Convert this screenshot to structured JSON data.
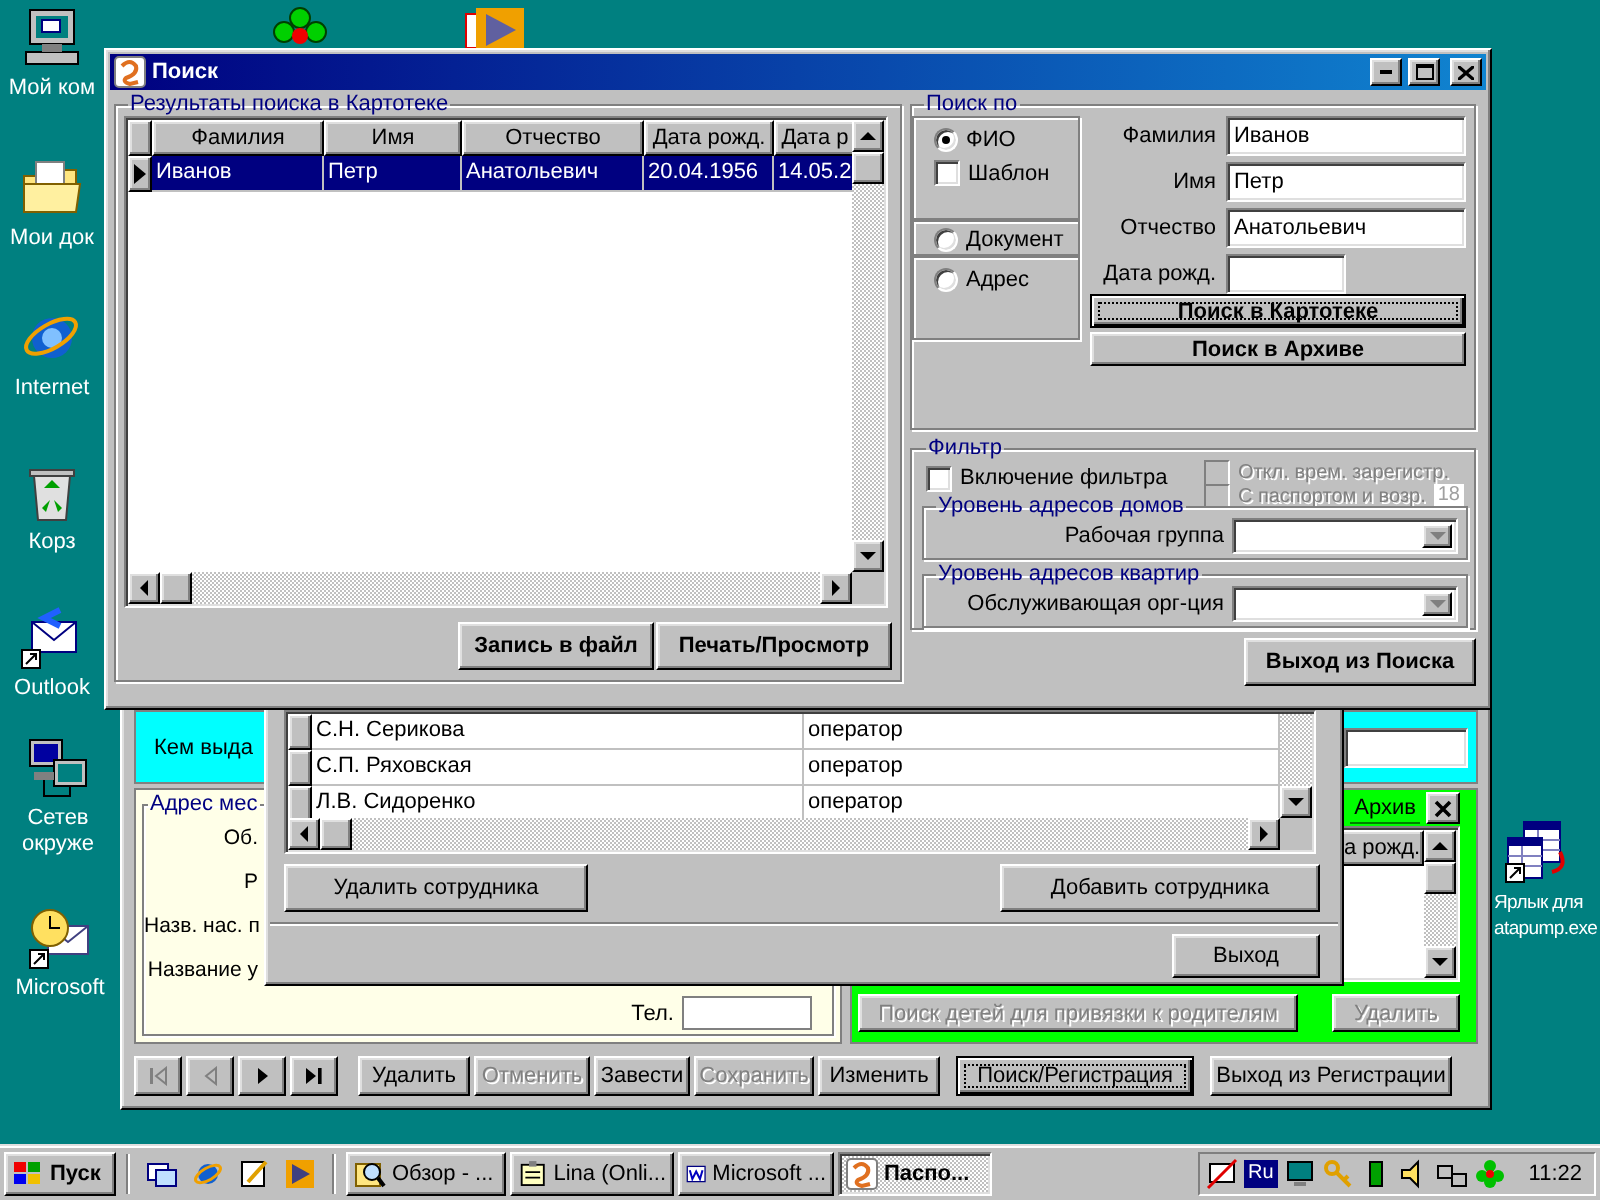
{
  "desktop_icons": [
    {
      "kind": "computer",
      "lines": [
        "Мой ком"
      ]
    },
    {
      "kind": "folder",
      "lines": [
        "Мои док"
      ]
    },
    {
      "kind": "browser",
      "lines": [
        "Internet"
      ]
    },
    {
      "kind": "recycle",
      "lines": [
        "Корз"
      ]
    },
    {
      "kind": "mail",
      "lines": [
        "Outlook"
      ]
    },
    {
      "kind": "network",
      "lines": [
        "Сетев",
        "окруже"
      ]
    },
    {
      "kind": "scheduler",
      "lines": [
        "Microsoft"
      ]
    },
    {
      "kind": "table",
      "lines": [
        "Ярлык для",
        "atapump.exe"
      ]
    }
  ],
  "registration_window": {
    "issued_by_label": "Кем выда",
    "address": {
      "title": "Адрес мес",
      "labels": [
        "Об.",
        "Р",
        "Назв. нас. п",
        "Название у"
      ],
      "phone_label": "Тел."
    },
    "archive": {
      "tab": "Архив",
      "column": "а рожд.",
      "buttons": [
        {
          "label": "Поиск детей для привязки к родителям",
          "disabled": true
        },
        {
          "label": "Удалить",
          "disabled": true
        }
      ]
    },
    "navigator": [
      {
        "kind": "first",
        "disabled": true
      },
      {
        "kind": "prev",
        "disabled": true
      },
      {
        "kind": "next",
        "disabled": false
      },
      {
        "kind": "last",
        "disabled": false
      }
    ],
    "toolbar": [
      {
        "label": "Удалить",
        "disabled": false,
        "focused": false
      },
      {
        "label": "Отменить",
        "disabled": true,
        "focused": false
      },
      {
        "label": "Завести",
        "disabled": false,
        "focused": false
      },
      {
        "label": "Сохранить",
        "disabled": true,
        "focused": false
      },
      {
        "label": "Изменить",
        "disabled": false,
        "focused": false
      },
      {
        "label": "Поиск/Регистрация",
        "disabled": false,
        "focused": true
      },
      {
        "label": "Выход из Регистрации",
        "disabled": false,
        "focused": false
      }
    ]
  },
  "staff_window": {
    "rows": [
      {
        "name": "С.Н. Серикова",
        "role": "оператор"
      },
      {
        "name": "С.П. Ряховская",
        "role": "оператор"
      },
      {
        "name": "Л.В. Сидоренко",
        "role": "оператор"
      }
    ],
    "buttons": [
      "Удалить сотрудника",
      "Добавить сотрудника"
    ],
    "exit_button": "Выход"
  },
  "search_window": {
    "title": "Поиск",
    "results": {
      "title": "Результаты поиска в Картотеке",
      "columns": [
        "Фамилия",
        "Имя",
        "Отчество",
        "Дата рожд.",
        "Дата р"
      ],
      "rows": [
        {
          "cells": [
            "Иванов",
            "Петр",
            "Анатольевич",
            "20.04.1956",
            "14.05.2"
          ],
          "selected": true
        }
      ]
    },
    "result_buttons": [
      "Запись в файл",
      "Печать/Просмотр"
    ],
    "search_by": {
      "title": "Поиск по",
      "options": [
        {
          "kind": "radio",
          "label": "ФИО",
          "selected": true
        },
        {
          "kind": "checkbox",
          "label": "Шаблон",
          "checked": false
        },
        {
          "kind": "radio",
          "label": "Документ",
          "selected": false
        },
        {
          "kind": "radio",
          "label": "Адрес",
          "selected": false
        }
      ]
    },
    "fields": [
      {
        "label": "Фамилия",
        "value": "Иванов"
      },
      {
        "label": "Имя",
        "value": "Петр"
      },
      {
        "label": "Отчество",
        "value": "Анатольевич"
      },
      {
        "label": "Дата рожд."
      }
    ],
    "search_buttons": [
      {
        "label": "Поиск в Картотеке",
        "focused": true
      },
      {
        "label": "Поиск в Архиве",
        "focused": false
      }
    ],
    "filter": {
      "title": "Фильтр",
      "enable": {
        "label": "Включение фильтра",
        "checked": false
      },
      "options": [
        {
          "label": "Откл. врем. зарегистр.",
          "checked": false,
          "disabled": true
        },
        {
          "label": "С паспортом и возр.",
          "checked": false,
          "disabled": true
        }
      ],
      "age": "18",
      "groups": [
        {
          "title": "Уровень адресов домов",
          "label": "Рабочая группа"
        },
        {
          "title": "Уровень адресов квартир",
          "label": "Обслуживающая орг-ция"
        }
      ]
    },
    "exit_button": "Выход из Поиска"
  },
  "taskbar": {
    "start": "Пуск",
    "tasks": [
      {
        "kind": "explorer",
        "label": "Обзор - ...",
        "selected": false
      },
      {
        "kind": "notepad",
        "label": "Lina (Onli...",
        "selected": false
      },
      {
        "kind": "word",
        "label": "Microsoft ...",
        "selected": false
      },
      {
        "kind": "app",
        "label": "Паспо...",
        "selected": true
      }
    ],
    "language": "Ru",
    "clock": "11:22"
  }
}
